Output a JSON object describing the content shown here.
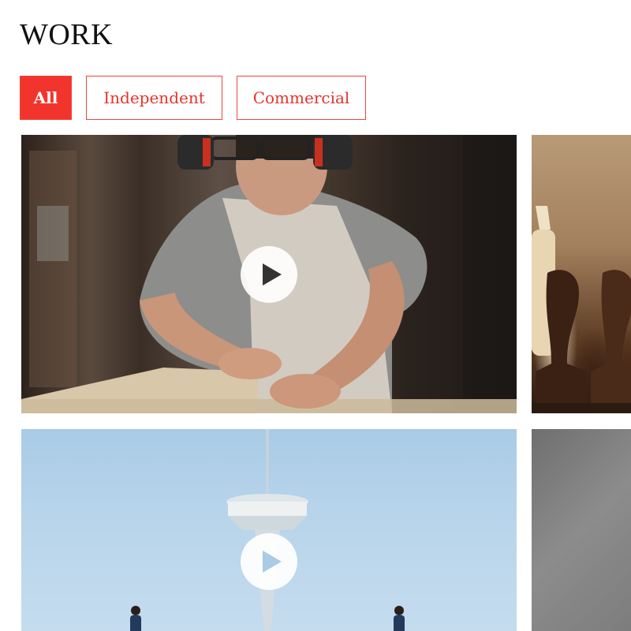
{
  "page": {
    "title": "WORK"
  },
  "filters": [
    {
      "label": "All",
      "active": true
    },
    {
      "label": "Independent",
      "active": false
    },
    {
      "label": "Commercial",
      "active": false
    }
  ],
  "colors": {
    "accent": "#f2352c",
    "title": "#111111"
  },
  "cards": [
    {
      "thumbnail": "woodworker",
      "icon": "play-icon"
    },
    {
      "thumbnail": "chess-pieces"
    },
    {
      "thumbnail": "space-needle",
      "icon": "play-icon"
    },
    {
      "thumbnail": "gray-abstract"
    }
  ]
}
